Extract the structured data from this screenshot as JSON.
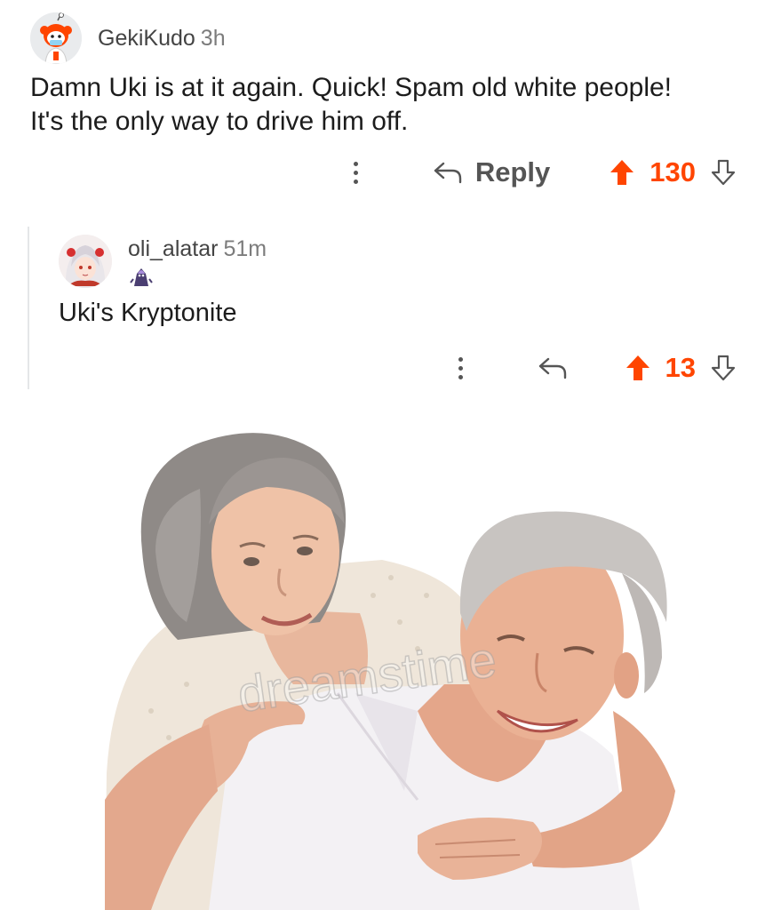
{
  "comment1": {
    "username": "GekiKudo",
    "time": "3h",
    "body_lines": [
      "Damn Uki is at it again. Quick! Spam old white people!",
      "It's the only way to drive him off."
    ],
    "reply_label": "Reply",
    "vote_count": "130"
  },
  "comment2": {
    "username": "oli_alatar",
    "time": "51m",
    "body": "Uki's Kryptonite",
    "vote_count": "13"
  },
  "image": {
    "watermark": "dreamstime"
  },
  "colors": {
    "upvote": "#ff4500",
    "text": "#1c1c1c",
    "meta": "#7c7c7c",
    "thread_line": "#e4e6e8"
  },
  "icons": {
    "avatar1": "snoo-avatar-icon",
    "avatar2": "anime-avatar-icon",
    "flair": "character-flair-icon",
    "more": "more-options-icon",
    "reply": "reply-arrow-icon",
    "upvote": "upvote-arrow-icon",
    "downvote": "downvote-arrow-icon"
  }
}
